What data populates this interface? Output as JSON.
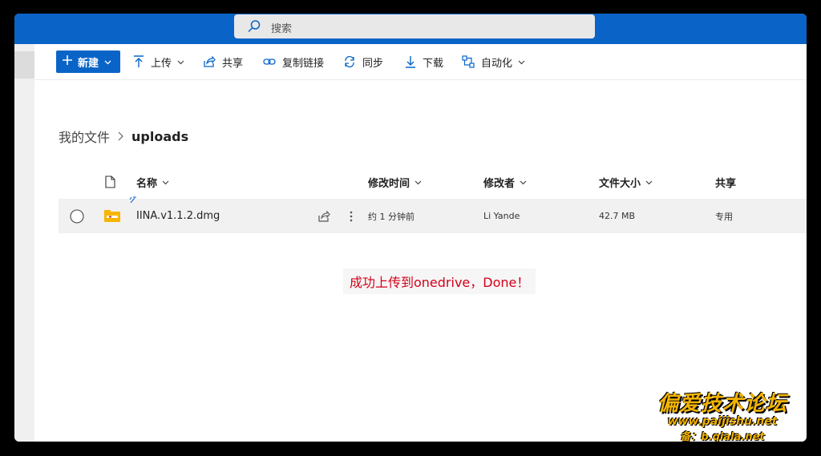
{
  "search": {
    "placeholder": "搜索"
  },
  "toolbar": {
    "new_label": "新建",
    "upload_label": "上传",
    "share_label": "共享",
    "copy_link_label": "复制链接",
    "sync_label": "同步",
    "download_label": "下载",
    "automate_label": "自动化"
  },
  "breadcrumb": {
    "root": "我的文件",
    "current": "uploads"
  },
  "columns": {
    "name": "名称",
    "modified": "修改时间",
    "modified_by": "修改者",
    "size": "文件大小",
    "sharing": "共享"
  },
  "files": [
    {
      "name": "IINA.v1.1.2.dmg",
      "modified": "约 1 分钟前",
      "modified_by": "Li Yande",
      "size": "42.7 MB",
      "sharing": "专用"
    }
  ],
  "annotation": "成功上传到onedrive，Done！",
  "watermark": {
    "title": "偏爱技术论坛",
    "url": "www.paijishu.net",
    "sub": "备：b.qiala.net"
  },
  "colors": {
    "brand": "#0a64c8",
    "annotation": "#d4001a",
    "watermark": "#f2b300"
  }
}
